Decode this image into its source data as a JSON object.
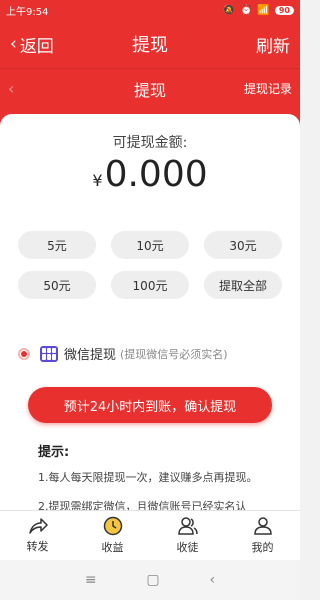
{
  "status": {
    "time": "上午9:54",
    "battery": "90"
  },
  "header": {
    "back_label": "返回",
    "title": "提现",
    "refresh_label": "刷新"
  },
  "subheader": {
    "title": "提现",
    "record_label": "提现记录"
  },
  "balance": {
    "label": "可提现金额:",
    "currency": "¥",
    "amount": "0.000"
  },
  "amounts": [
    "5元",
    "10元",
    "30元",
    "50元",
    "100元",
    "提取全部"
  ],
  "method": {
    "name": "微信提现",
    "hint": "(提现微信号必须实名)"
  },
  "confirm_label": "预计24小时内到账，确认提现",
  "tips": {
    "title": "提示:",
    "items": [
      "1.每人每天限提现一次，建议赚多点再提现。",
      "2.提现需绑定微信，且微信账号已经实名认"
    ]
  },
  "tabs": [
    "转发",
    "收益",
    "收徒",
    "我的"
  ],
  "colors": {
    "accent": "#e8312f"
  }
}
